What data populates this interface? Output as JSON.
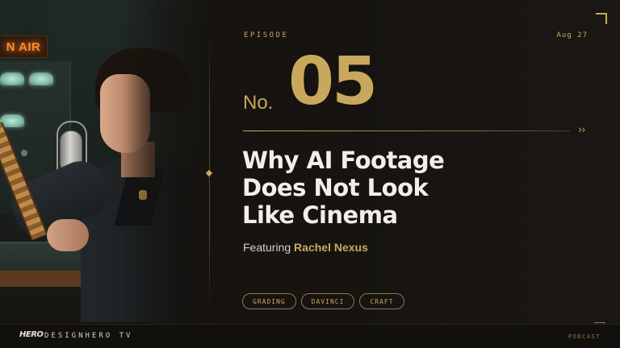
{
  "photo": {
    "sign_text": "N AIR"
  },
  "episode": {
    "label": "EPISODE",
    "date": "Aug 27",
    "prefix": "No.",
    "number": "05"
  },
  "headline": {
    "lines": [
      "Why AI Footage",
      "Does Not Look",
      "Like Cinema"
    ]
  },
  "featuring": {
    "label": "Featuring",
    "name": "Rachel Nexus"
  },
  "tags": [
    "GRADING",
    "DAVINCI",
    "CRAFT"
  ],
  "footer": {
    "logo": "HERO",
    "brand": "DESIGNHERO TV",
    "category": "PODCAST"
  },
  "icons": {
    "chevrons": "double-chevron-right-icon"
  },
  "colors": {
    "accent": "#c9a85d",
    "background": "#15120f",
    "headline": "#f3efe6",
    "on_air": "#ff8a2a"
  }
}
